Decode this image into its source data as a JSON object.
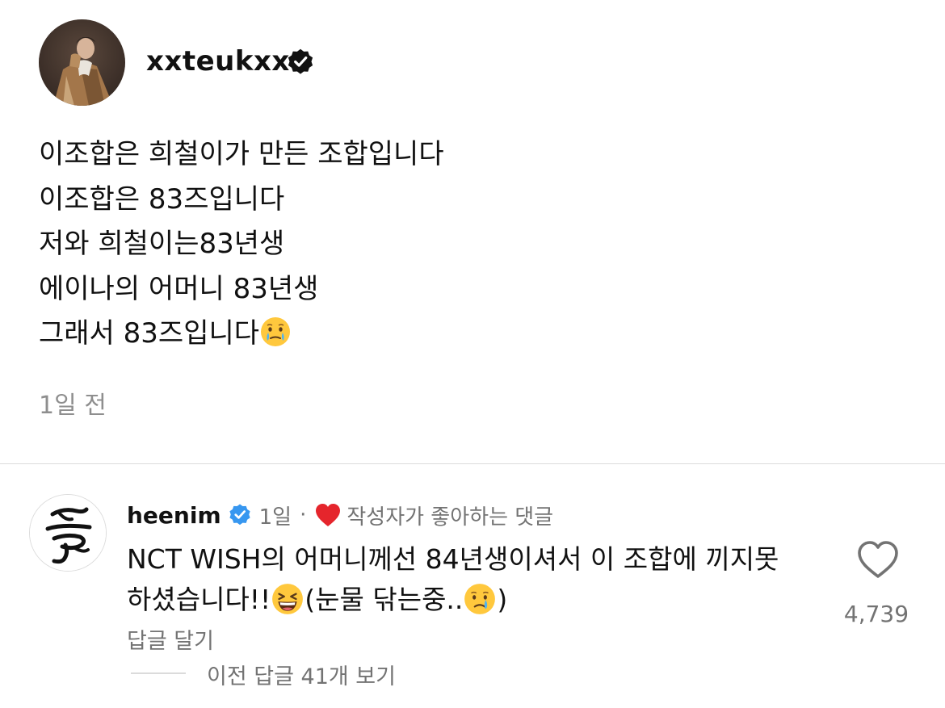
{
  "post": {
    "username": "xxteukxx",
    "caption_lines": [
      "이조합은 희철이가 만든 조합입니다",
      "이조합은 83즈입니다",
      "저와 희철이는83년생",
      "에이나의 어머니 83년생",
      "그래서 83즈입니다"
    ],
    "caption_emoji": "face-holding-back-tears",
    "time": "1일 전"
  },
  "comment": {
    "username": "heenim",
    "age": "1일",
    "separator": "·",
    "liked_by_author_label": "작성자가 좋아하는 댓글",
    "text_line1": "NCT WISH의 어머니께선 84년생이셔서 이 조합에 끼지못",
    "text_line2_a": "하셨습니다!!",
    "text_line2_b": "(눈물 닦는중..",
    "text_line2_c": ")",
    "emojis": [
      "grinning-squinting-face",
      "crying-face"
    ],
    "like_count": "4,739",
    "reply_label": "답글 달기",
    "view_replies_label": "이전 답글 41개 보기"
  },
  "colors": {
    "text": "#111111",
    "secondary": "#737373",
    "verified_dark": "#111111",
    "verified_blue": "#3797f0",
    "heart_red": "#e5252c",
    "divider": "#dbdbdb"
  }
}
